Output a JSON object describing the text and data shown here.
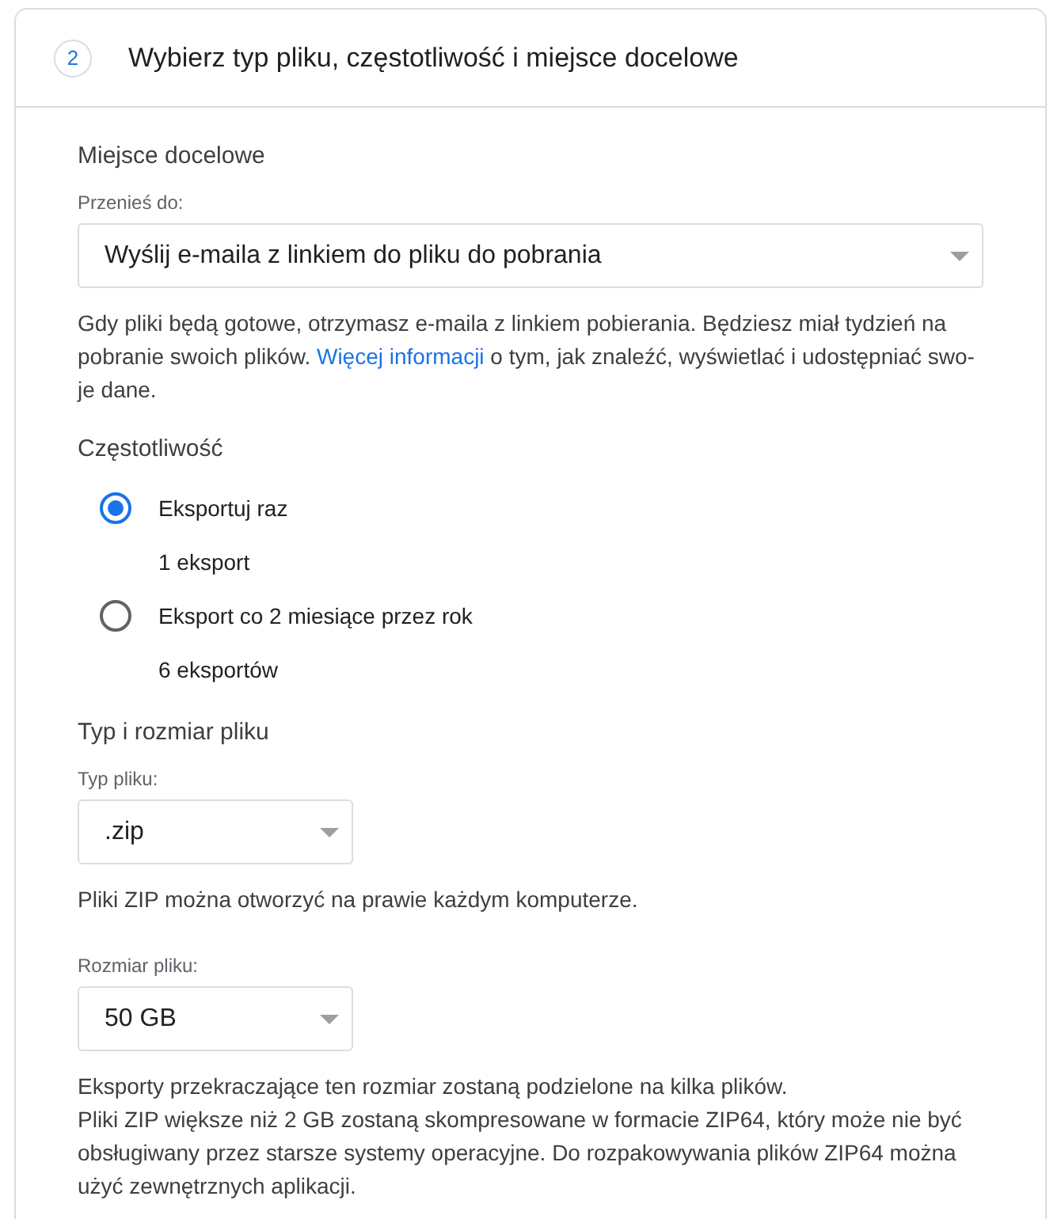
{
  "header": {
    "step": "2",
    "title": "Wybierz typ pliku, częstotliwość i miejsce docelowe"
  },
  "destination": {
    "heading": "Miejsce docelowe",
    "label": "Przenieś do:",
    "value": "Wyślij e-maila z linkiem do pliku do pobrania",
    "help_before": "Gdy pliki będą gotowe, otrzymasz e-maila z linkiem pobierania. Będziesz miał tydzień na pobranie swoich plików.",
    "help_link": "Więcej informacji",
    "help_after": "o tym, jak znaleźć, wyświetlać i udostępniać swo-je dane."
  },
  "frequency": {
    "heading": "Częstotliwość",
    "options": [
      {
        "label": "Eksportuj raz",
        "detail": "1 eksport",
        "selected": true
      },
      {
        "label": "Eksport co 2 miesiące przez rok",
        "detail": "6 eksportów",
        "selected": false
      }
    ]
  },
  "file": {
    "heading": "Typ i rozmiar pliku",
    "type_label": "Typ pliku:",
    "type_value": ".zip",
    "type_help": "Pliki ZIP można otworzyć na prawie każdym komputerze.",
    "size_label": "Rozmiar pliku:",
    "size_value": "50 GB",
    "size_help": [
      "Eksporty przekraczające ten rozmiar zostaną podzielone na kilka plików.",
      "Pliki ZIP większe niż 2 GB zostaną skompresowane w formacie ZIP64, który może nie być obsługiwany przez starsze systemy operacyjne. Do rozpakowywania plików ZIP64 można użyć zewnętrznych aplikacji."
    ]
  }
}
